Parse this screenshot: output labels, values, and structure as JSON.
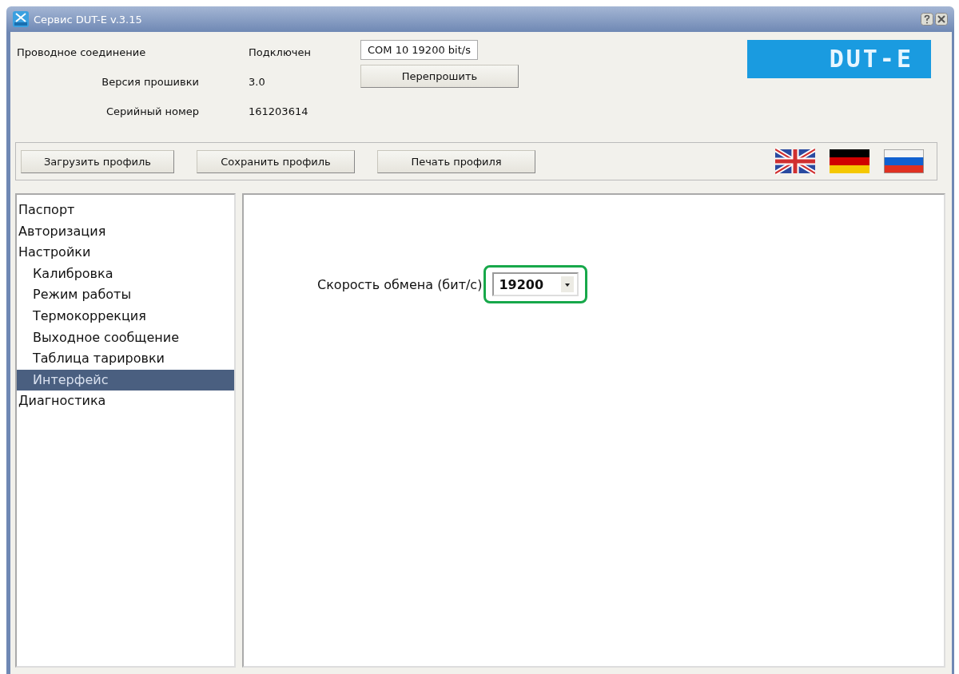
{
  "window": {
    "title": "Сервис DUT-E  v.3.15"
  },
  "info": [
    {
      "label": "Проводное соединение",
      "value": "Подключен"
    },
    {
      "label": "Версия прошивки",
      "value": "3.0"
    },
    {
      "label": "Серийный номер",
      "value": "161203614"
    }
  ],
  "port": {
    "value": "COM 10   19200 bit/s"
  },
  "flash_button": "Перепрошить",
  "logo": "DUT-E",
  "profile_buttons": [
    "Загрузить профиль",
    "Сохранить профиль",
    "Печать профиля"
  ],
  "languages": [
    {
      "kind": "uk"
    },
    {
      "kind": "de"
    },
    {
      "kind": "ru"
    }
  ],
  "tree": [
    {
      "label": "Паспорт",
      "selected": false
    },
    {
      "label": "Авторизация",
      "selected": false
    },
    {
      "label": "Настройки",
      "selected": false,
      "children": [
        {
          "label": "Калибровка",
          "selected": false
        },
        {
          "label": "Режим работы",
          "selected": false
        },
        {
          "label": "Термокоррекция",
          "selected": false
        },
        {
          "label": "Выходное сообщение",
          "selected": false
        },
        {
          "label": "Таблица тарировки",
          "selected": false
        },
        {
          "label": "Интерфейс",
          "selected": true
        }
      ]
    },
    {
      "label": "Диагностика",
      "selected": false
    }
  ],
  "speed": {
    "label": "Скорость обмена (бит/с)",
    "value": "19200",
    "highlighted": true
  }
}
